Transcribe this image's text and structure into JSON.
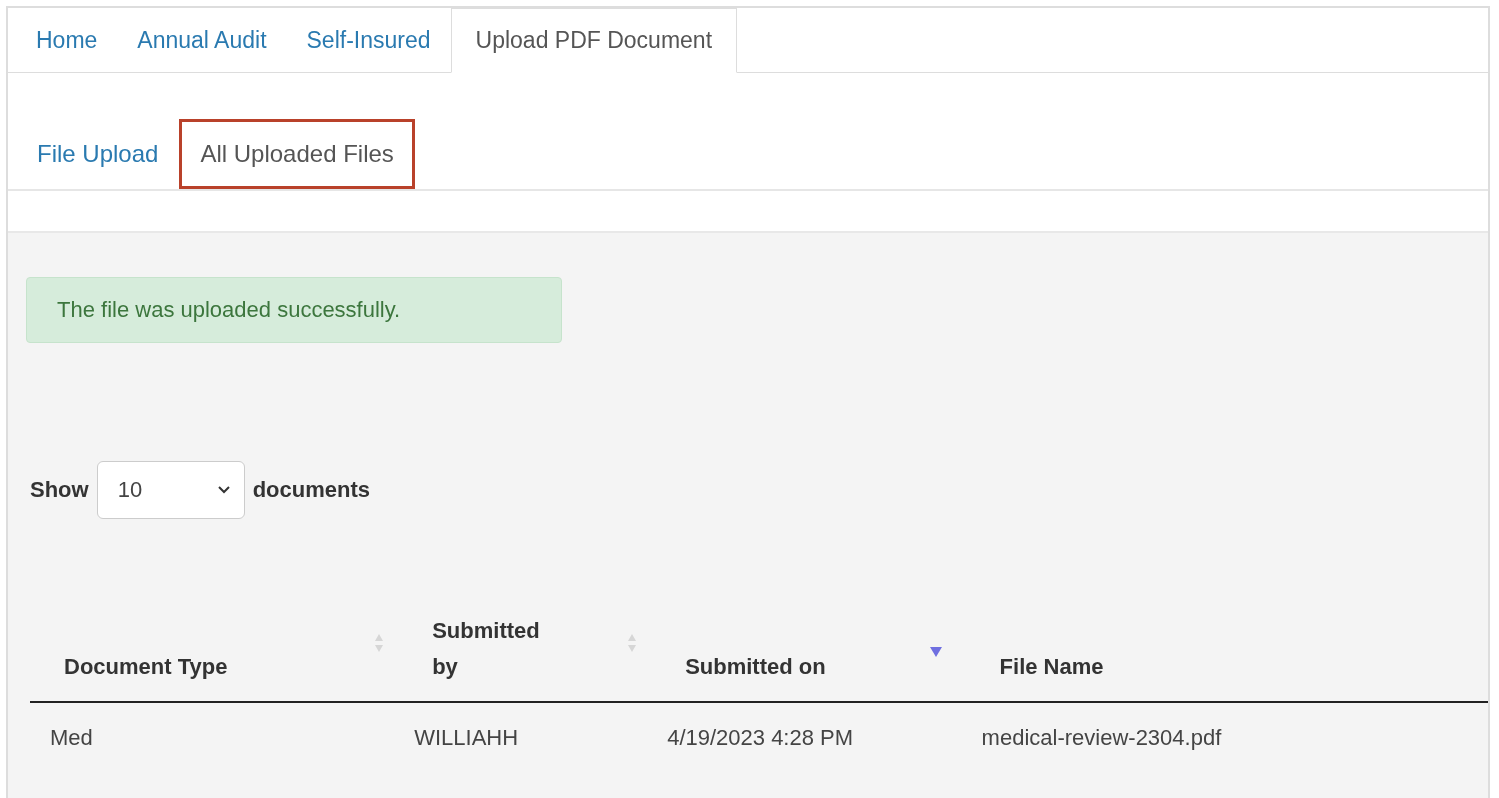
{
  "tabs": [
    {
      "label": "Home",
      "selected": false
    },
    {
      "label": "Annual Audit",
      "selected": false
    },
    {
      "label": "Self-Insured",
      "selected": false
    },
    {
      "label": "Upload PDF Document",
      "selected": true
    }
  ],
  "subtabs": [
    {
      "label": "File Upload",
      "selected": false,
      "highlighted": false
    },
    {
      "label": "All Uploaded Files",
      "selected": true,
      "highlighted": true
    }
  ],
  "alert": {
    "text": "The file was uploaded successfully."
  },
  "length_control": {
    "before": "Show",
    "value": "10",
    "after": "documents"
  },
  "table": {
    "columns": [
      {
        "label": "Document Type",
        "sortable": true,
        "sorted": false
      },
      {
        "label": "Submitted by",
        "sortable": true,
        "sorted": false
      },
      {
        "label": "Submitted on",
        "sortable": true,
        "sorted": true
      },
      {
        "label": "File Name",
        "sortable": false
      }
    ],
    "rows": [
      [
        "Med",
        "WILLIAHH",
        "4/19/2023 4:28 PM",
        "medical-review-2304.pdf"
      ]
    ]
  }
}
